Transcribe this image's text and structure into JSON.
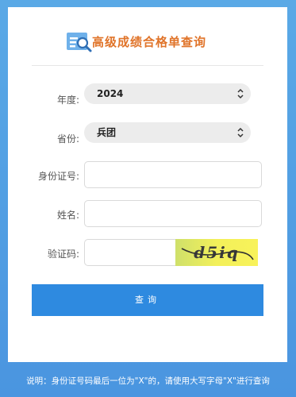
{
  "header": {
    "title": "高级成绩合格单查询",
    "logo_icon": "search-document-icon"
  },
  "form": {
    "year": {
      "label": "年度:",
      "value": "2024"
    },
    "province": {
      "label": "省份:",
      "value": "兵团"
    },
    "id_number": {
      "label": "身份证号:",
      "value": "",
      "placeholder": ""
    },
    "name": {
      "label": "姓名:",
      "value": "",
      "placeholder": ""
    },
    "captcha": {
      "label": "验证码:",
      "value": "",
      "placeholder": "",
      "image_text": "d5iq"
    }
  },
  "submit_label": "查询",
  "note": "说明：身份证号码最后一位为\"X\"的，请使用大写字母\"X\"进行查询",
  "colors": {
    "background": "#4a95e0",
    "title": "#e0742a",
    "button": "#2e8ae0",
    "captcha_bg": "#f3f05a"
  }
}
